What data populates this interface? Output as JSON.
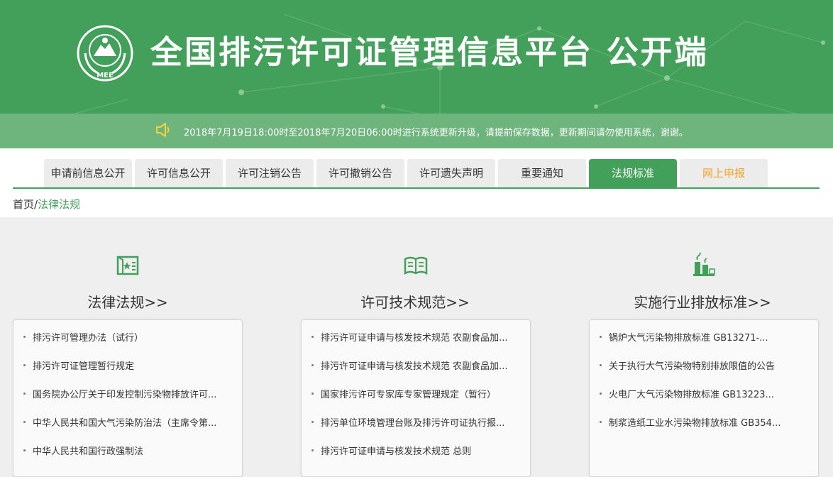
{
  "header": {
    "title": "全国排污许可证管理信息平台  公开端",
    "logo_text": "MEE"
  },
  "notice": {
    "text": "2018年7月19日18:00时至2018年7月20日06:00时进行系统更新升级，请提前保存数据，更新期间请勿使用系统，谢谢。"
  },
  "tabs": [
    {
      "label": "申请前信息公开"
    },
    {
      "label": "许可信息公开"
    },
    {
      "label": "许可注销公告"
    },
    {
      "label": "许可撤销公告"
    },
    {
      "label": "许可遗失声明"
    },
    {
      "label": "重要通知"
    },
    {
      "label": "法规标准"
    },
    {
      "label": "网上申报"
    }
  ],
  "breadcrumb": {
    "home": "首页",
    "sep": "/",
    "current": "法律法规"
  },
  "colors": {
    "green": "#43a05a",
    "orange": "#f2a324"
  },
  "columns": [
    {
      "title": "法律法规>>",
      "icon": "law-book-icon",
      "items": [
        "排污许可管理办法（试行）",
        "排污许可证管理暂行规定",
        "国务院办公厅关于印发控制污染物排放许可...",
        "中华人民共和国大气污染防治法（主席令第...",
        "中华人民共和国行政强制法"
      ]
    },
    {
      "title": "许可技术规范>>",
      "icon": "open-book-icon",
      "items": [
        "排污许可证申请与核发技术规范 农副食品加...",
        "排污许可证申请与核发技术规范 农副食品加...",
        "国家排污许可专家库专家管理规定（暂行）",
        "排污单位环境管理台账及排污许可证执行报...",
        "排污许可证申请与核发技术规范 总则"
      ]
    },
    {
      "title": "实施行业排放标准>>",
      "icon": "factory-icon",
      "items": [
        "锅炉大气污染物排放标准 GB13271-...",
        "关于执行大气污染物特别排放限值的公告",
        "火电厂大气污染物排放标准 GB13223...",
        "制浆造纸工业水污染物排放标准 GB354..."
      ]
    }
  ]
}
